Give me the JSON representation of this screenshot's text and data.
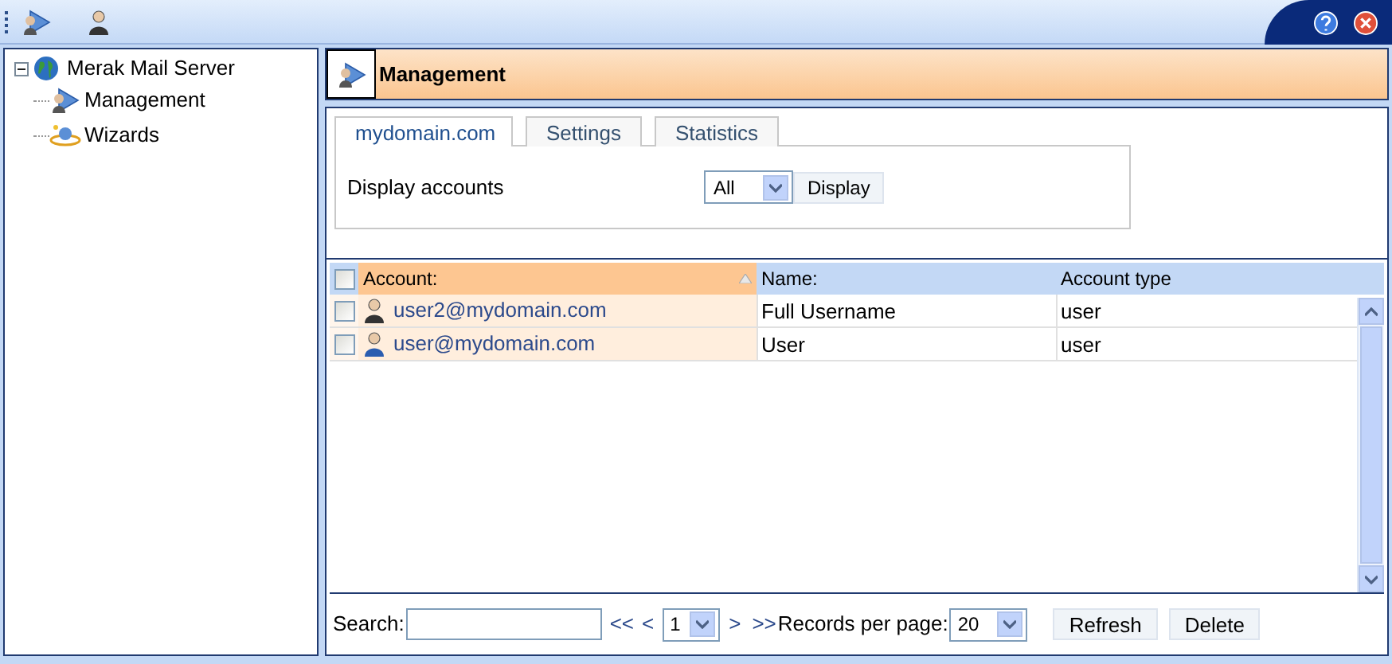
{
  "tree": [
    {
      "label": "Merak Mail Server",
      "kind": "globe",
      "expanded": true,
      "children": [
        {
          "label": "Management",
          "kind": "management"
        },
        {
          "label": "Wizards",
          "kind": "wizard"
        }
      ]
    }
  ],
  "header": {
    "title": "Management"
  },
  "tabs": [
    {
      "label": "mydomain.com",
      "selected": true
    },
    {
      "label": "Settings",
      "selected": false
    },
    {
      "label": "Statistics",
      "selected": false
    }
  ],
  "display": {
    "label": "Display accounts",
    "select_value": "All",
    "button": "Display"
  },
  "table": {
    "select_all_checked": false,
    "columns": [
      {
        "label": "Account:",
        "sorted": true
      },
      {
        "label": "Name:",
        "sorted": false
      },
      {
        "label": "Account type",
        "sorted": false
      }
    ],
    "rows": [
      {
        "checked": false,
        "kind": "admin",
        "account": "user2@mydomain.com",
        "name": "Full Username",
        "type": "user"
      },
      {
        "checked": false,
        "kind": "user",
        "account": "user@mydomain.com",
        "name": "User",
        "type": "user"
      }
    ]
  },
  "footer": {
    "search_label": "Search:",
    "first": "<<",
    "prev": "<",
    "page": "1",
    "next": ">",
    "last": ">>",
    "records_label": "Records per page:",
    "records": "20",
    "buttons": [
      "Refresh",
      "Delete"
    ]
  }
}
